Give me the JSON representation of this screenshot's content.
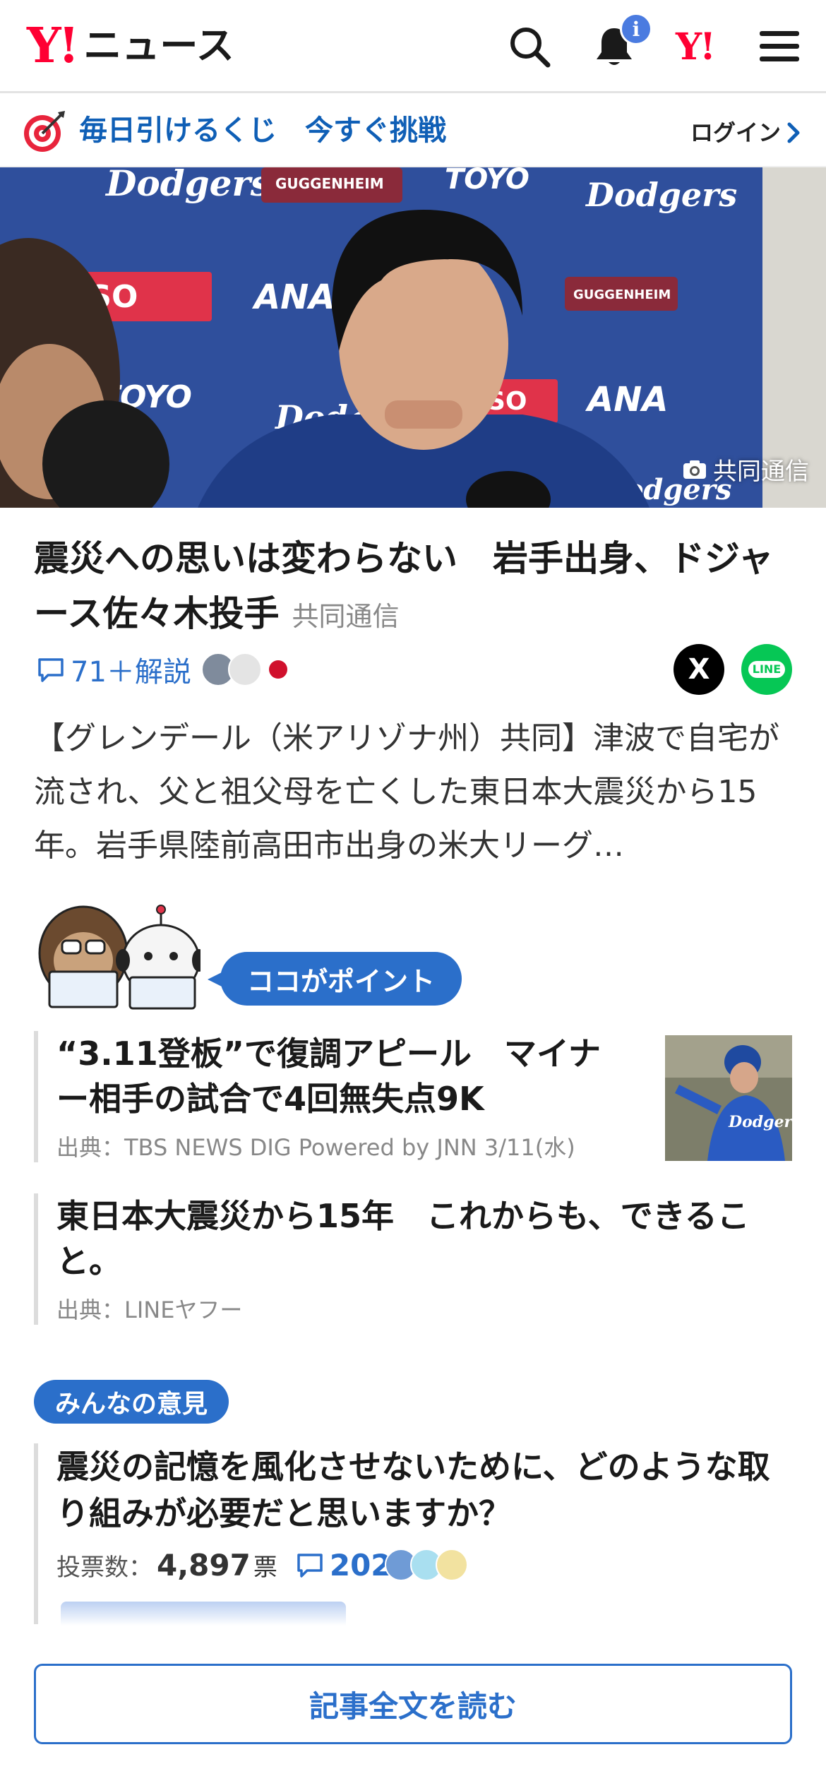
{
  "header": {
    "logo_mark": "Y!",
    "logo_text": "ニュース",
    "notification_badge": "i",
    "yahoo_mark": "Y!"
  },
  "promo": {
    "text": "毎日引けるくじ　今すぐ挑戦",
    "login_label": "ログイン"
  },
  "hero": {
    "photo_credit": "共同通信"
  },
  "article": {
    "title": "震災への思いは変わらない　岩手出身、ドジャース佐々木投手",
    "source": "共同通信",
    "comment_label": "71＋解説",
    "share_x": "X",
    "share_line": "LINE",
    "summary": "【グレンデール（米アリゾナ州）共同】津波で自宅が流され、父と祖父母を亡くした東日本大震災から15年。岩手県陸前高田市出身の米大リーグ…"
  },
  "point": {
    "label": "ココがポイント",
    "items": [
      {
        "title": "“3.11登板”で復調アピール　マイナー相手の試合で4回無失点9K",
        "meta": "出典：TBS NEWS DIG Powered by JNN 3/11(水)"
      },
      {
        "title": "東日本大震災から15年　これからも、できること。",
        "meta": "出典：LINEヤフー"
      }
    ]
  },
  "opinion": {
    "label": "みんなの意見",
    "question": "震災の記憶を風化させないために、どのような取り組みが必要だと思いますか？",
    "votes_label": "投票数：",
    "votes_count": "4,897",
    "votes_unit": "票",
    "comment_count": "202"
  },
  "read_more": "記事全文を読む",
  "colors": {
    "brand_red": "#ff0033",
    "link_blue": "#2b6fca",
    "promo_blue": "#0f5fb6",
    "line_green": "#06c755"
  }
}
